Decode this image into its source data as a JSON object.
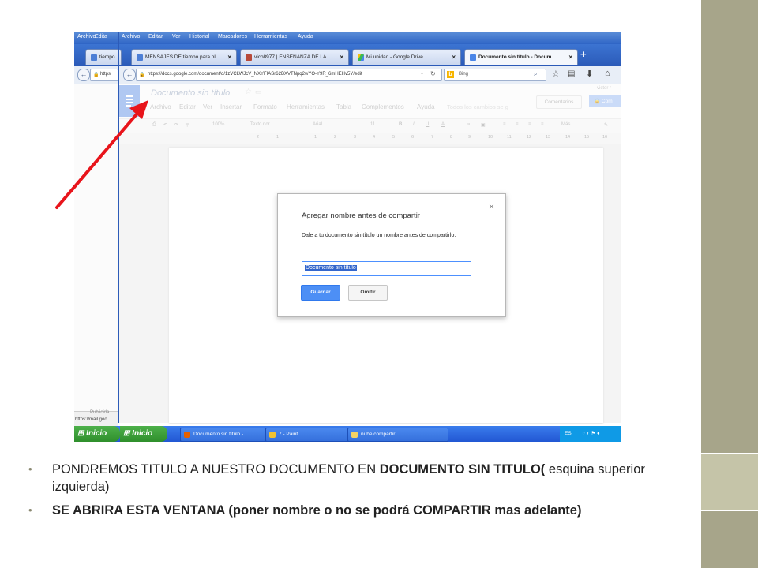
{
  "screenshot": {
    "menu": [
      "Archivo",
      "Edita",
      "Archivo",
      "Editar",
      "Ver",
      "Historial",
      "Marcadores",
      "Herramientas",
      "Ayuda"
    ],
    "tabs": [
      {
        "label": "tiempo",
        "icon": "search-icon"
      },
      {
        "label": "MENSAJES DE tiempo para ol...",
        "icon": "search-icon"
      },
      {
        "label": "vico8977 | ENSEÑANZA DE LA...",
        "icon": "site-icon"
      },
      {
        "label": "Mi unidad - Google Drive",
        "icon": "drive-icon"
      },
      {
        "label": "Documento sin título - Docum...",
        "icon": "docs-icon"
      }
    ],
    "new_tab": "+",
    "url_left": "https",
    "url": "https://docs.google.com/document/d/1zVCLWJcV_NXYFIASr62BXVTNpq2wYO-Y9R_6mHEHv5Y/edit",
    "search_engine": "Bing",
    "doc": {
      "title": "Documento sin título",
      "menu": [
        "Archivo",
        "Editar",
        "Ver",
        "Insertar",
        "Formato",
        "Herramientas",
        "Tabla",
        "Complementos",
        "Ayuda"
      ],
      "save_status": "Todos los cambios se g",
      "user": "victor r",
      "comments_button": "Comentarios",
      "share_button": "Com",
      "toolbar": {
        "zoom": "100%",
        "style": "Texto nor...",
        "font": "Arial",
        "size": "11",
        "more": "Más"
      },
      "ruler": [
        "2",
        "1",
        "1",
        "2",
        "3",
        "4",
        "5",
        "6",
        "7",
        "8",
        "9",
        "10",
        "11",
        "12",
        "13",
        "14",
        "15",
        "16",
        "17",
        "18"
      ]
    },
    "dialog": {
      "title": "Agregar nombre antes de compartir",
      "close": "×",
      "description": "Dale a tu documento sin título un nombre antes de compartirlo:",
      "input_value": "Documento sin título",
      "save": "Guardar",
      "skip": "Omitir"
    },
    "status_left": "Publicida",
    "status_url": "https://mail.goo",
    "taskbar": {
      "start_labels": [
        "Inicio",
        "Inicio"
      ],
      "items": [
        "Documento sin título -...",
        "7 - Paint",
        "nube compartir"
      ],
      "tray_lang": "ES"
    }
  },
  "annotation": {
    "color": "#e8141b"
  },
  "bullets": [
    {
      "parts": [
        {
          "text": "PONDREMOS TITULO A NUESTRO DOCUMENTO EN ",
          "bold": false
        },
        {
          "text": "DOCUMENTO SIN TITULO(",
          "bold": true
        },
        {
          "text": " esquina superior izquierda)",
          "bold": false
        }
      ]
    },
    {
      "parts": [
        {
          "text": "SE ABRIRA ESTA VENTANA (poner nombre o no se podrá COMPARTIR mas adelante)",
          "bold": true
        }
      ]
    }
  ],
  "theme": {
    "accent": "#a7a58a",
    "accent_light": "#c5c4a8",
    "bullet": "#8a8870"
  }
}
